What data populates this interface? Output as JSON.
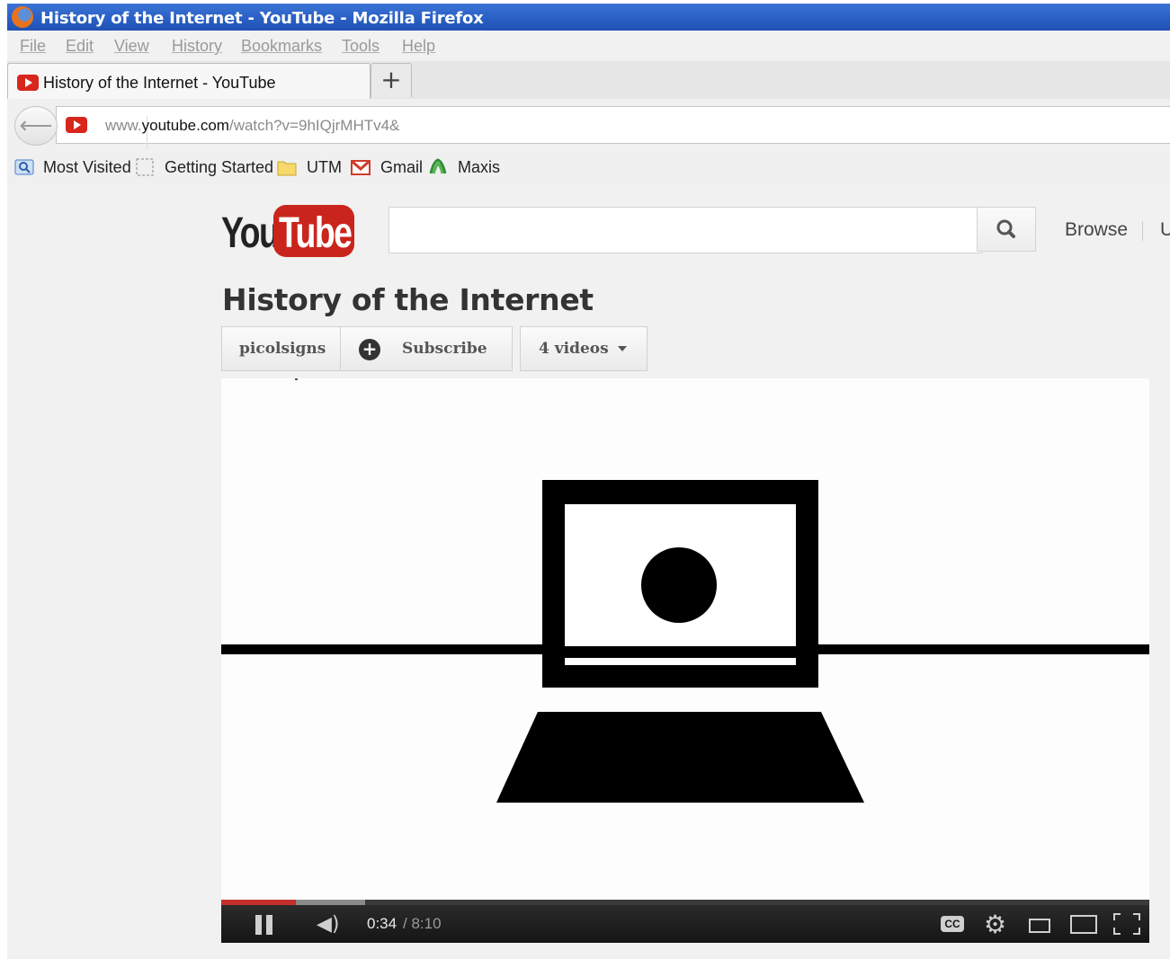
{
  "window": {
    "title": "History of the Internet - YouTube - Mozilla Firefox"
  },
  "menubar": {
    "items": [
      "File",
      "Edit",
      "View",
      "History",
      "Bookmarks",
      "Tools",
      "Help"
    ]
  },
  "tab": {
    "label": "History of the Internet - YouTube",
    "new_tab_symbol": "+"
  },
  "navbar": {
    "url_prefix": "www.",
    "url_domain": "youtube.com",
    "url_path": "/watch?v=9hIQjrMHTv4&",
    "back_symbol": "⟵"
  },
  "bookmarks": [
    "Most Visited",
    "Getting Started",
    "UTM",
    "Gmail",
    "Maxis"
  ],
  "youtube": {
    "logo_you": "You",
    "logo_tube": "Tube",
    "search_placeholder": "",
    "browse_label": "Browse",
    "upload_cut": "U"
  },
  "video": {
    "title": "History of the Internet",
    "channel": "picolsigns",
    "subscribe_label": "Subscribe",
    "videos_label": "4 videos",
    "time_current": "0:34",
    "time_total": "/ 8:10",
    "progress_played": 0.08,
    "progress_buffered": 0.155,
    "cc_label": "CC"
  },
  "colors": {
    "titlebar": "#2a5fc4",
    "youtube_red": "#c9251c",
    "progress_played": "#c4302b"
  },
  "icons": {
    "volume": "speaker-icon",
    "settings": "gear-icon",
    "search": "magnifier-icon"
  }
}
